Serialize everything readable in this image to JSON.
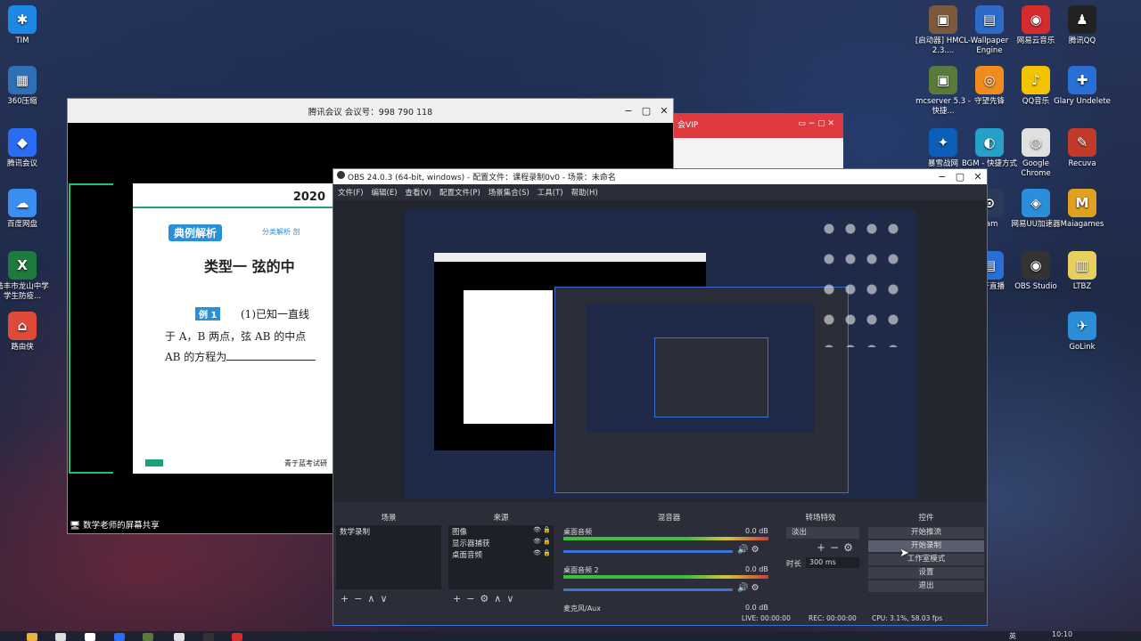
{
  "desktop": {
    "left_icons": [
      {
        "label": "TIM",
        "color": "#1e88e5",
        "glyph": "✱"
      },
      {
        "label": "360压缩",
        "color": "#2f6fb5",
        "glyph": "▦"
      },
      {
        "label": "腾讯会议",
        "color": "#2a6df4",
        "glyph": "◆"
      },
      {
        "label": "百度网盘",
        "color": "#3a8ef0",
        "glyph": "☁"
      },
      {
        "label": "陆丰市龙山中学学生防疫...",
        "color": "#1f7a3e",
        "glyph": "X"
      },
      {
        "label": "路由侠",
        "color": "#e04a3a",
        "glyph": "⌂"
      }
    ],
    "right_icons": [
      {
        "label": "[启动器] HMCL-2.3....",
        "color": "#7a5a3a",
        "glyph": "▣"
      },
      {
        "label": "Wallpaper Engine",
        "color": "#2e6ac8",
        "glyph": "▤"
      },
      {
        "label": "网易云音乐",
        "color": "#d42c2c",
        "glyph": "◉"
      },
      {
        "label": "腾讯QQ",
        "color": "#222",
        "glyph": "♟"
      },
      {
        "label": "mcserver 5.3 - 快捷...",
        "color": "#5a7a3a",
        "glyph": "▣"
      },
      {
        "label": "守望先锋",
        "color": "#f08c1e",
        "glyph": "◎"
      },
      {
        "label": "QQ音乐",
        "color": "#f2c300",
        "glyph": "♪"
      },
      {
        "label": "Glary Undelete",
        "color": "#2a6fd6",
        "glyph": "✚"
      },
      {
        "label": "暴雪战网",
        "color": "#0c5fb8",
        "glyph": "✦"
      },
      {
        "label": "BGM - 快捷方式",
        "color": "#26a0c8",
        "glyph": "◐"
      },
      {
        "label": "Google Chrome",
        "color": "#e0e0e0",
        "glyph": "◍"
      },
      {
        "label": "Recuva",
        "color": "#c23a2a",
        "glyph": "✎"
      },
      {
        "label": "eam",
        "color": "#2a3b5a",
        "glyph": "⊙"
      },
      {
        "label": "网易UU加速器",
        "color": "#2a8fd8",
        "glyph": "◈"
      },
      {
        "label": "Maiagames",
        "color": "#e0a020",
        "glyph": "M"
      },
      {
        "label": "虎牙直播",
        "color": "#2a6fd6",
        "glyph": "▤"
      },
      {
        "label": "OBS Studio",
        "color": "#333",
        "glyph": "◉"
      },
      {
        "label": "LTBZ",
        "color": "#e8d060",
        "glyph": "▥"
      },
      {
        "label": "GoLink",
        "color": "#2a8fd8",
        "glyph": "✈"
      }
    ]
  },
  "meeting_window": {
    "title": "腾讯会议 会议号：998 790 118",
    "share_label": "数学老师的屏幕共享",
    "slide": {
      "year": "2020",
      "section_badge": "典例解析",
      "section_sub": "分类解析 剖",
      "heading": "类型一  弦的中",
      "example_tag": "例 1",
      "line1": "(1)已知一直线",
      "line2": "于 A，B 两点，弦 AB 的中点",
      "line3": "AB 的方程为",
      "footer": "青于蓝考试研"
    }
  },
  "obs": {
    "title": "OBS 24.0.3 (64-bit, windows) - 配置文件：课程录制0v0 - 场景：未命名",
    "menu": [
      "文件(F)",
      "编辑(E)",
      "查看(V)",
      "配置文件(P)",
      "场景集合(S)",
      "工具(T)",
      "帮助(H)"
    ],
    "docks": {
      "scenes": {
        "title": "场景",
        "items": [
          "数学录制"
        ]
      },
      "sources": {
        "title": "来源",
        "items": [
          "图像",
          "显示器捕获",
          "桌面音频"
        ]
      },
      "mixer": {
        "title": "混音器",
        "tracks": [
          {
            "name": "桌面音频",
            "db": "0.0 dB"
          },
          {
            "name": "桌面音频 2",
            "db": "0.0 dB"
          },
          {
            "name": "麦克风/Aux",
            "db": "0.0 dB"
          }
        ]
      },
      "transitions": {
        "title": "转场特效",
        "selected": "淡出",
        "duration_label": "时长",
        "duration_value": "300 ms"
      },
      "controls": {
        "title": "控件",
        "buttons": [
          "开始推流",
          "开始录制",
          "工作室模式",
          "设置",
          "退出"
        ]
      }
    },
    "status": {
      "live": "LIVE: 00:00:00",
      "rec": "REC: 00:00:00",
      "cpu": "CPU: 3.1%, 58.03 fps"
    }
  },
  "taskbar": {
    "time": "10:10",
    "ime": "英"
  }
}
